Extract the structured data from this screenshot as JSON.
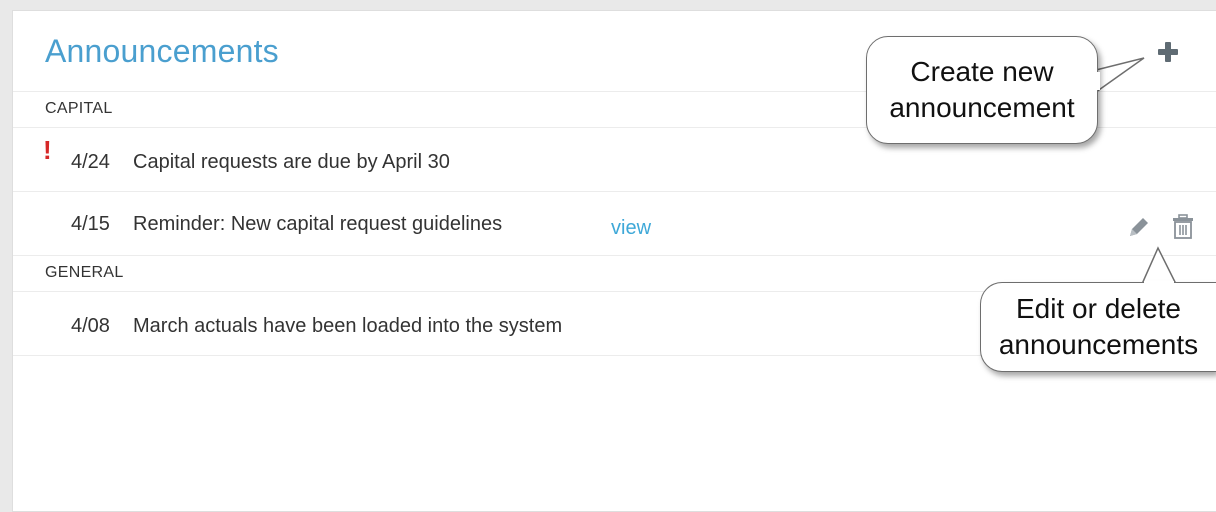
{
  "panel": {
    "title": "Announcements",
    "add_icon": "plus-icon"
  },
  "sections": [
    {
      "label": "CAPITAL",
      "items": [
        {
          "alert": true,
          "date": "4/24",
          "text": "Capital requests are due by April 30"
        },
        {
          "alert": false,
          "date": "4/15",
          "text": "Reminder: New capital request guidelines",
          "link": "view",
          "actions": [
            "pencil-icon",
            "trash-icon"
          ]
        }
      ]
    },
    {
      "label": "GENERAL",
      "items": [
        {
          "alert": false,
          "date": "4/08",
          "text": "March actuals have been loaded into the system"
        }
      ]
    }
  ],
  "callouts": {
    "create": {
      "line1": "Create new",
      "line2": "announcement"
    },
    "edit": {
      "line1": "Edit or delete",
      "line2": "announcements"
    }
  },
  "colors": {
    "title": "#4a9fcf",
    "link": "#3ea8d8",
    "alert": "#d62828",
    "icon": "#8a9299"
  }
}
